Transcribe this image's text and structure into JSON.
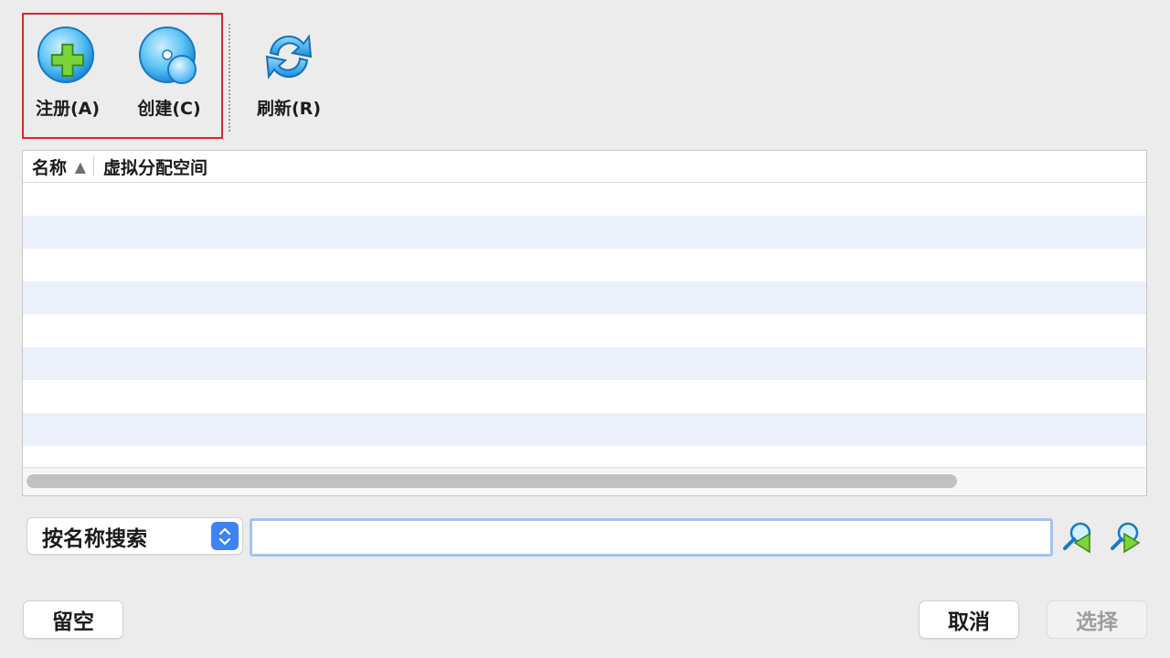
{
  "toolbar": {
    "register_label": "注册(A)",
    "create_label": "创建(C)",
    "refresh_label": "刷新(R)"
  },
  "table": {
    "columns": [
      "名称",
      "虚拟分配空间"
    ],
    "sort_indicator": "▲",
    "rows": []
  },
  "search": {
    "type_selected": "按名称搜索",
    "value": "",
    "placeholder": ""
  },
  "buttons": {
    "leave_empty": "留空",
    "cancel": "取消",
    "choose": "选择"
  },
  "colors": {
    "highlight_border": "#d9262b",
    "row_stripe": "#ebf0fb",
    "accent": "#3d83f5",
    "input_focus": "#a4c2ee"
  }
}
